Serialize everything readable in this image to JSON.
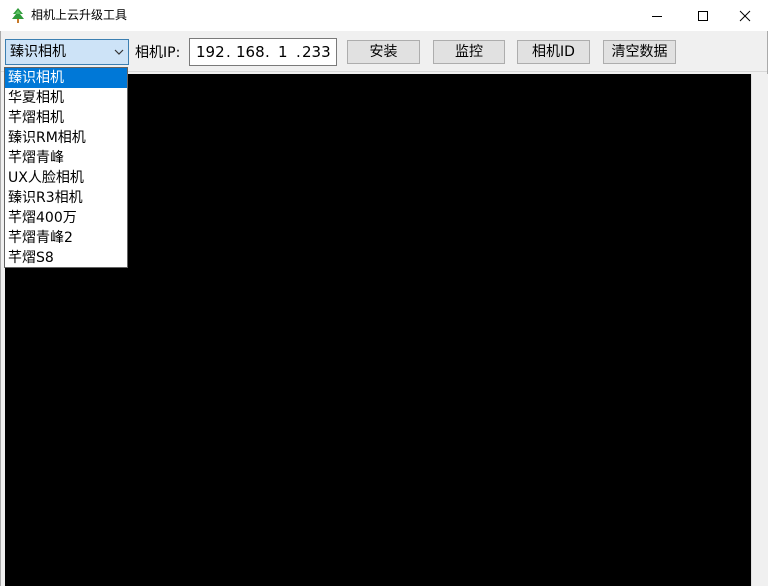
{
  "window": {
    "title": "相机上云升级工具",
    "icon": "tree-icon"
  },
  "toolbar": {
    "combo_value": "臻识相机",
    "ip_label": "相机IP:",
    "ip_octets": [
      "192",
      "168",
      "1",
      "233"
    ],
    "buttons": {
      "install": "安装",
      "monitor": "监控",
      "camera_id": "相机ID",
      "clear_data": "清空数据"
    }
  },
  "dropdown": {
    "selected_index": 0,
    "items": [
      "臻识相机",
      "华夏相机",
      "芊熠相机",
      "臻识RM相机",
      "芊熠青峰",
      "UX人脸相机",
      "臻识R3相机",
      "芊熠400万",
      "芊熠青峰2",
      "芊熠S8"
    ]
  },
  "colors": {
    "selection": "#0078d7",
    "console_bg": "#000000",
    "combo_focus_bg": "#cde3f7"
  }
}
